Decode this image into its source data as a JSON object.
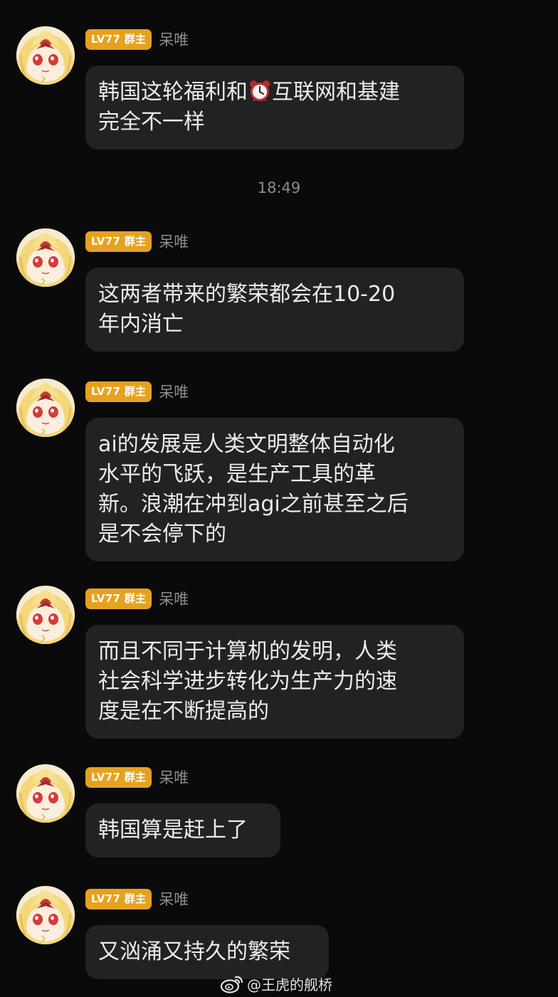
{
  "messages": [
    {
      "badge": "LV77 群主",
      "sender": "呆唯",
      "lines": [
        "韩国这轮福利和",
        "完全不一样"
      ],
      "alarm_after": "互联网和基建"
    },
    {
      "badge": "LV77 群主",
      "sender": "呆唯",
      "lines": [
        "这两者带来的繁荣都会在10-20",
        "年内消亡"
      ]
    },
    {
      "badge": "LV77 群主",
      "sender": "呆唯",
      "lines": [
        "ai的发展是人类文明整体自动化",
        "水平的飞跃，是生产工具的革",
        "新。浪潮在冲到agi之前甚至之后",
        "是不会停下的"
      ]
    },
    {
      "badge": "LV77 群主",
      "sender": "呆唯",
      "lines": [
        "而且不同于计算机的发明，人类",
        "社会科学进步转化为生产力的速",
        "度是在不断提高的"
      ]
    },
    {
      "badge": "LV77 群主",
      "sender": "呆唯",
      "lines": [
        "韩国算是赶上了"
      ]
    },
    {
      "badge": "LV77 群主",
      "sender": "呆唯",
      "lines": [
        "又汹涌又持久的繁荣"
      ]
    }
  ],
  "timestamp": "18:49",
  "watermark": "@王虎的舰桥",
  "icons": {
    "alarm": "alarm-clock-emoji",
    "watermark": "weibo-logo-icon",
    "avatar": "anime-girl-avatar"
  },
  "colors": {
    "background": "#0a0a0a",
    "bubble": "#222224",
    "badge": "#e6a21f",
    "secondary_text": "#8d8d8d",
    "primary_text": "#ececec"
  }
}
